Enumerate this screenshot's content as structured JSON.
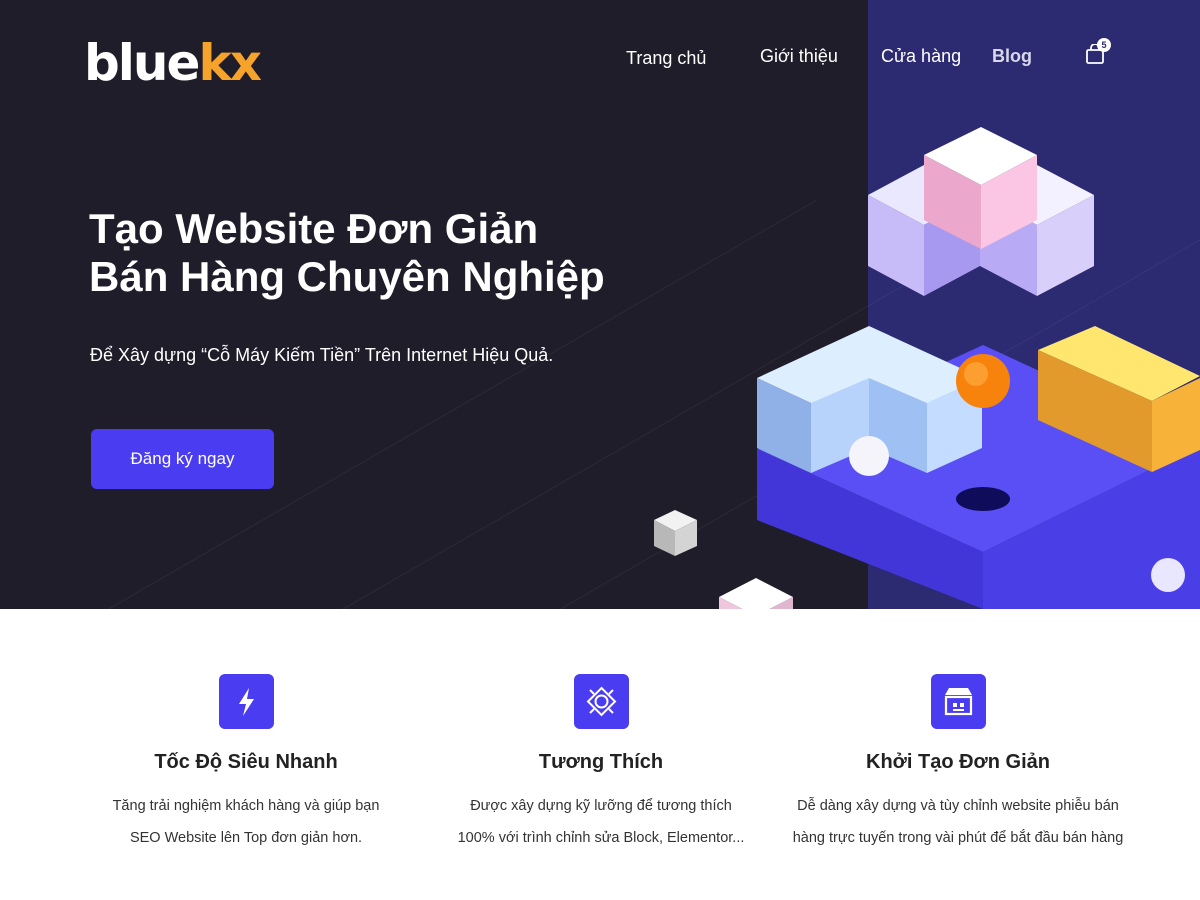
{
  "brand": {
    "logo_main": "blue",
    "logo_accent": "kx"
  },
  "nav": {
    "items": [
      {
        "label": "Trang chủ"
      },
      {
        "label": "Giới thiệu"
      },
      {
        "label": "Cửa hàng"
      },
      {
        "label": "Blog"
      }
    ],
    "cart_count": "5"
  },
  "hero": {
    "title_line1": "Tạo Website Đơn Giản",
    "title_line2": "Bán Hàng Chuyên Nghiệp",
    "subtitle": "Để Xây dựng “Cỗ Máy Kiếm Tiền” Trên Internet Hiệu Quả.",
    "cta_label": "Đăng ký ngay"
  },
  "features": [
    {
      "icon": "lightning-icon",
      "title": "Tốc Độ Siêu Nhanh",
      "line1": "Tăng trải nghiệm khách hàng và giúp bạn",
      "line2": "SEO Website lên Top đơn giản hơn."
    },
    {
      "icon": "compatible-badge-icon",
      "title": "Tương Thích",
      "line1": "Được xây dựng kỹ lưỡng để tương thích",
      "line2": "100% với trình chỉnh sửa Block, Elementor..."
    },
    {
      "icon": "store-icon",
      "title": "Khởi Tạo Đơn Giản",
      "line1": "Dễ dàng xây dựng và tùy chỉnh website phiễu bán",
      "line2": "hàng trực tuyến trong vài phút để bắt đầu bán hàng"
    }
  ],
  "colors": {
    "hero_bg": "#1e1d29",
    "hero_right_bg": "#2c2a70",
    "accent": "#4a3cf0",
    "logo_accent": "#f5a32a"
  }
}
